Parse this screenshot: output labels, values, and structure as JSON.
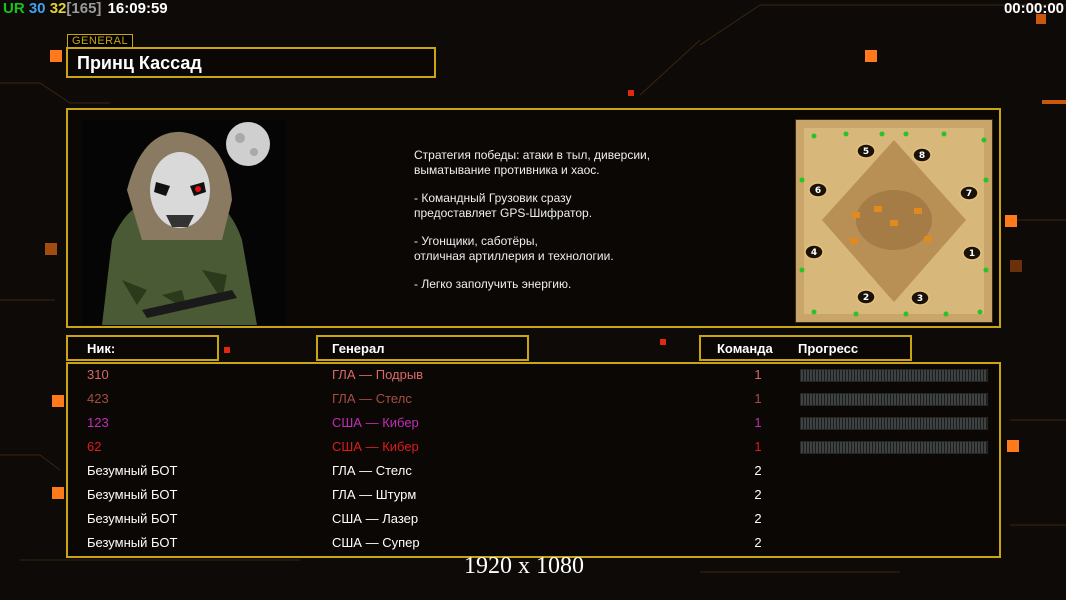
{
  "hud": {
    "left_ur": "UR",
    "left_fps": "30",
    "left_num": "32",
    "left_bracket": "[165]",
    "left_time": "16:09:59",
    "right_time": "00:00:00"
  },
  "general": {
    "tag": "GENERAL",
    "name": "Принц Кассад",
    "description": [
      "Стратегия победы: атаки в тыл, диверсии,\n выматывание противника и хаос.",
      "- Командный Грузовик сразу\nпредоставляет GPS-Шифратор.",
      "- Угонщики, саботёры,\nотличная артиллерия и технологии.",
      "- Легко заполучить энергию."
    ]
  },
  "map": {
    "spawn_labels": [
      "5",
      "8",
      "6",
      "7",
      "4",
      "1",
      "2",
      "3"
    ]
  },
  "columns": {
    "nick": "Ник:",
    "general": "Генерал",
    "team": "Команда",
    "progress": "Прогресс"
  },
  "players": [
    {
      "nick": "310",
      "general": "ГЛА — Подрыв",
      "team": "1",
      "color": "#d86a66",
      "progress": 0
    },
    {
      "nick": "423",
      "general": "ГЛА — Стелс",
      "team": "1",
      "color": "#a4503e",
      "progress": 0
    },
    {
      "nick": "123",
      "general": "США — Кибер",
      "team": "1",
      "color": "#c02eb4",
      "progress": 0
    },
    {
      "nick": "62",
      "general": "США — Кибер",
      "team": "1",
      "color": "#dd1d1d",
      "progress": 0
    },
    {
      "nick": "Безумный БОТ",
      "general": "ГЛА — Стелс",
      "team": "2",
      "color": "#ffffff"
    },
    {
      "nick": "Безумный БОТ",
      "general": "ГЛА — Штурм",
      "team": "2",
      "color": "#ffffff"
    },
    {
      "nick": "Безумный БОТ",
      "general": "США — Лазер",
      "team": "2",
      "color": "#ffffff"
    },
    {
      "nick": "Безумный БОТ",
      "general": "США — Супер",
      "team": "2",
      "color": "#ffffff"
    }
  ],
  "resolution": "1920 x 1080",
  "colors": {
    "accent": "#c9a514",
    "hud_ur": "#19c419",
    "hud_fps": "#3fa1f0",
    "hud_num": "#e0d33a",
    "hud_bracket": "#9a9a9a"
  }
}
